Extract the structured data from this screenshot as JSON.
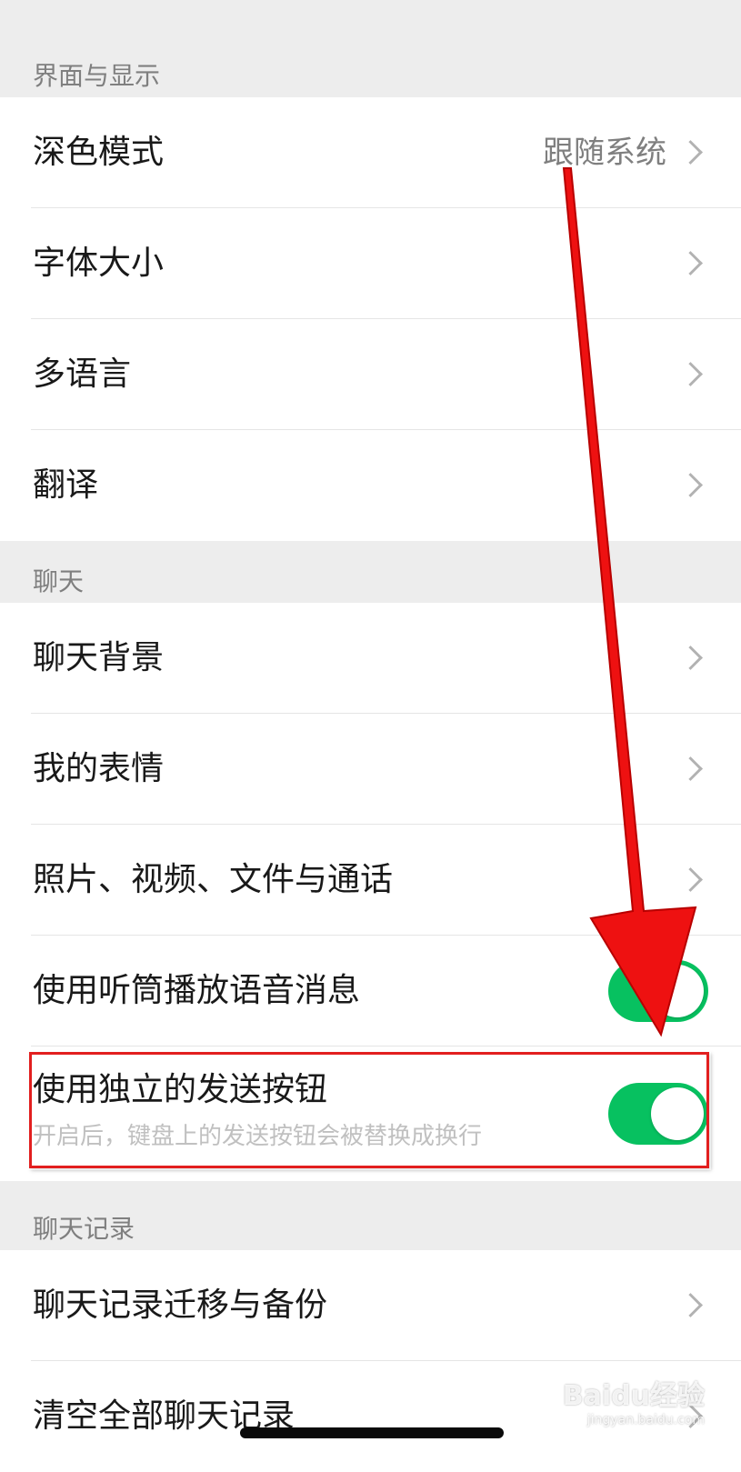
{
  "sections": {
    "display": {
      "header": "界面与显示",
      "items": [
        {
          "label": "深色模式",
          "value": "跟随系统"
        },
        {
          "label": "字体大小"
        },
        {
          "label": "多语言"
        },
        {
          "label": "翻译"
        }
      ]
    },
    "chat": {
      "header": "聊天",
      "items": [
        {
          "label": "聊天背景"
        },
        {
          "label": "我的表情"
        },
        {
          "label": "照片、视频、文件与通话"
        },
        {
          "label": "使用听筒播放语音消息",
          "toggle_on": true
        },
        {
          "label": "使用独立的发送按钮",
          "sublabel": "开启后，键盘上的发送按钮会被替换成换行",
          "toggle_on": true
        }
      ]
    },
    "history": {
      "header": "聊天记录",
      "items": [
        {
          "label": "聊天记录迁移与备份"
        },
        {
          "label": "清空全部聊天记录"
        }
      ]
    }
  },
  "watermark": {
    "brand": "Baidu经验",
    "url": "jingyan.baidu.com"
  },
  "colors": {
    "accent_green": "#07c160",
    "annotation_red": "#e21f1f",
    "background": "#ededed",
    "cell": "#ffffff"
  }
}
